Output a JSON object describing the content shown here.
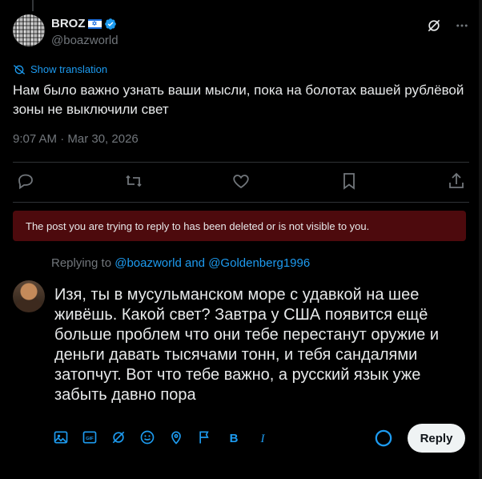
{
  "post": {
    "author_name": "BROZ",
    "author_flag": "✡",
    "author_handle": "@boazworld",
    "translation_label": "Show translation",
    "text": "Нам было важно узнать ваши мысли, пока на болотах вашей рублёвой зоны  не выключили свет",
    "timestamp": "9:07 AM · Mar 30, 2026"
  },
  "actions": [
    "reply-icon",
    "repost-icon",
    "like-icon",
    "bookmark-icon",
    "share-icon"
  ],
  "banner": {
    "text": "The post you are trying to reply to has been deleted or is not visible to you.",
    "color": "#4d0a0d"
  },
  "reply": {
    "replying_prefix": "Replying to",
    "mention1": "@boazworld",
    "and_word": "and",
    "mention2": "@Goldenberg1996",
    "text": "Изя, ты в мусульманском море с удавкой на шее живёшь. Какой свет? Завтра у США появится ещё больше проблем что они тебе перестанут оружие и деньги давать тысячами тонн, и тебя сандалями затопчут. Вот что тебе важно, а русский язык уже забыть давно пора",
    "button_label": "Reply"
  },
  "toolbar": [
    "image-icon",
    "gif-icon",
    "grok-icon",
    "emoji-icon",
    "location-icon",
    "flag-icon",
    "bold-icon",
    "italic-icon"
  ],
  "colors": {
    "accent": "#1d9bf0",
    "muted": "#71767b",
    "text": "#e7e9ea",
    "background": "#000000"
  }
}
